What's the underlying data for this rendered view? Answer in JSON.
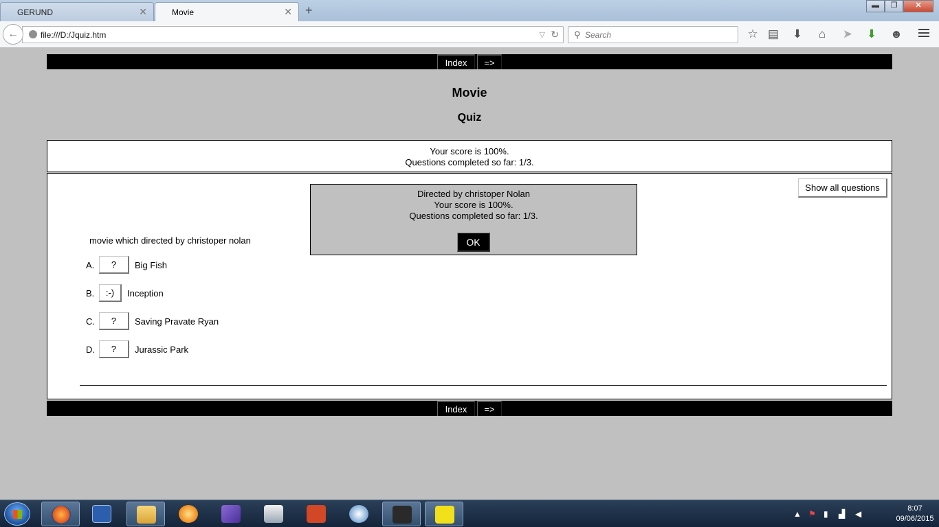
{
  "browser": {
    "tabs": [
      {
        "label": "GERUND",
        "active": false
      },
      {
        "label": "Movie",
        "active": true
      }
    ],
    "new_tab_label": "+",
    "window_controls": {
      "minimize": "▬",
      "maximize": "❐",
      "close": "✕"
    },
    "url": "file:///D:/Jquiz.htm",
    "search_placeholder": "Search",
    "toolbar_icons": [
      "star-icon",
      "reading-list-icon",
      "download-icon",
      "home-icon",
      "send-icon",
      "download-green-icon",
      "smiley-icon",
      "menu-icon"
    ]
  },
  "page": {
    "nav": {
      "index_label": "Index",
      "next_label": "=>"
    },
    "title": "Movie",
    "subtitle": "Quiz",
    "score": {
      "line1": "Your score is 100%.",
      "line2": "Questions completed so far: 1/3."
    },
    "show_all_label": "Show all questions",
    "question": "movie which directed by christoper nolan",
    "answers": [
      {
        "letter": "A.",
        "button": "?",
        "text": "Big Fish"
      },
      {
        "letter": "B.",
        "button": ":-)",
        "text": "Inception"
      },
      {
        "letter": "C.",
        "button": "?",
        "text": "Saving Pravate Ryan"
      },
      {
        "letter": "D.",
        "button": "?",
        "text": "Jurassic Park"
      }
    ],
    "feedback": {
      "line1": "Directed by christoper Nolan",
      "line2": "Your score is 100%.",
      "line3": "Questions completed so far: 1/3.",
      "ok_label": "OK"
    }
  },
  "taskbar": {
    "apps": [
      "firefox-icon",
      "word-icon",
      "explorer-icon",
      "media-icon",
      "visual-studio-icon",
      "video-editor-icon",
      "powerpoint-icon",
      "paint-icon",
      "app-hand-icon",
      "app-hand-yellow-icon"
    ],
    "clock": {
      "time": "8:07",
      "date": "09/06/2015"
    }
  },
  "colors": {
    "page_bg": "#c0c0c0",
    "nav_strip": "#000000",
    "panel_bg": "#ffffff"
  }
}
